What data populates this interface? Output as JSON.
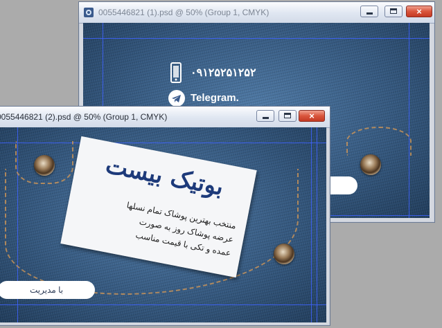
{
  "window_back": {
    "title": "0055446821 (1).psd @ 50% (Group 1, CMYK)",
    "phone": "۰۹۱۲۵۲۵۱۲۵۲",
    "telegram": "Telegram."
  },
  "window_front": {
    "title": "0055446821 (2).psd @ 50% (Group 1, CMYK)",
    "card_title": "بوتیک بیست",
    "card_lines": [
      "منتخب بهترین پوشاک تمام نسلها",
      "عرضه پوشاک روز به صورت",
      "عمده و تکی با قیمت مناسب"
    ],
    "badge_text": "با مدیریت"
  },
  "window_buttons": {
    "close_glyph": "×"
  },
  "colors": {
    "guide": "#3e63ff",
    "title_text": "#7d8694",
    "card_title": "#1d3a7a"
  }
}
